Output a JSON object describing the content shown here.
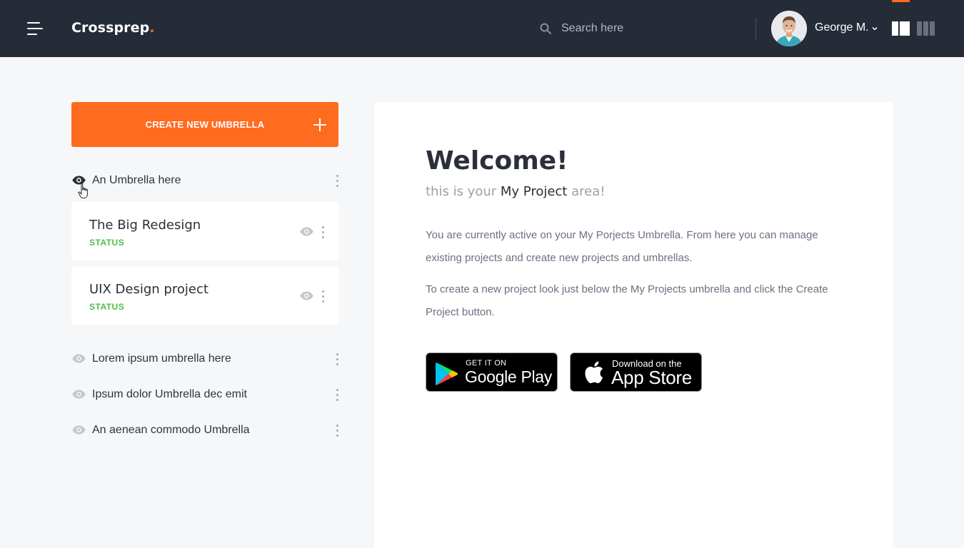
{
  "header": {
    "logo_text": "Crossprep",
    "logo_dot": ".",
    "search": {
      "placeholder": "Search here",
      "value": ""
    },
    "user": {
      "name": "George M."
    }
  },
  "sidebar": {
    "create_button_label": "CREATE NEW UMBRELLA",
    "umbrellas_top": [
      {
        "label": "An Umbrella here"
      }
    ],
    "projects": [
      {
        "title": "The Big Redesign",
        "status": "STATUS"
      },
      {
        "title": "UIX Design project",
        "status": "STATUS"
      }
    ],
    "umbrellas_bottom": [
      {
        "label": "Lorem ipsum umbrella here"
      },
      {
        "label": "Ipsum dolor Umbrella dec emit"
      },
      {
        "label": "An aenean commodo Umbrella"
      }
    ]
  },
  "main": {
    "title": "Welcome!",
    "subtitle_prefix": "this is your ",
    "subtitle_emphasis": "My Project",
    "subtitle_suffix": " area!",
    "paragraph_1": "You are currently active on your My Porjects Umbrella. From here you can manage existing projects and create new projects and umbrellas.",
    "paragraph_2": "To create a new project look just below the My Projects umbrella and click the Create Project button.",
    "google_play": {
      "small": "GET IT ON",
      "big": "Google Play"
    },
    "app_store": {
      "small": "Download on the",
      "big": "App Store"
    }
  },
  "colors": {
    "accent": "#ff6b1f",
    "topbar": "#262b38",
    "status_green": "#4cc04b",
    "background": "#f6f7f9"
  },
  "icons": {
    "menu": "hamburger-icon",
    "search": "search-icon",
    "user_caret": "chevron-down-icon",
    "create": "plus-icon",
    "visibility": "eye-icon",
    "more": "kebab-icon",
    "layout_single": "layout-single-icon",
    "layout_multi": "layout-columns-icon"
  }
}
